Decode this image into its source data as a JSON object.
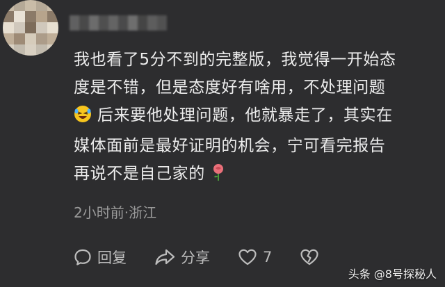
{
  "comment": {
    "lines": [
      "我也看了5分不到的完整版，我觉得一开始态",
      "度是不错，但是态度好有啥用，不处理问题",
      "后来要他处理问题，他就暴走了，其实在",
      "媒体面前是最好证明的机会，宁可看完报告",
      "再说不是自己家的"
    ],
    "emoji_laugh": "laughing-emoji",
    "emoji_rose": "rose-emoji"
  },
  "meta": {
    "time_location": "2小时前·浙江"
  },
  "actions": {
    "reply_label": "回复",
    "share_label": "分享",
    "like_count": "7"
  },
  "watermark": "头条 @8号探秘人",
  "colors": {
    "background": "#2d2d2f",
    "text": "#ececec",
    "muted": "#9a9a9a"
  }
}
